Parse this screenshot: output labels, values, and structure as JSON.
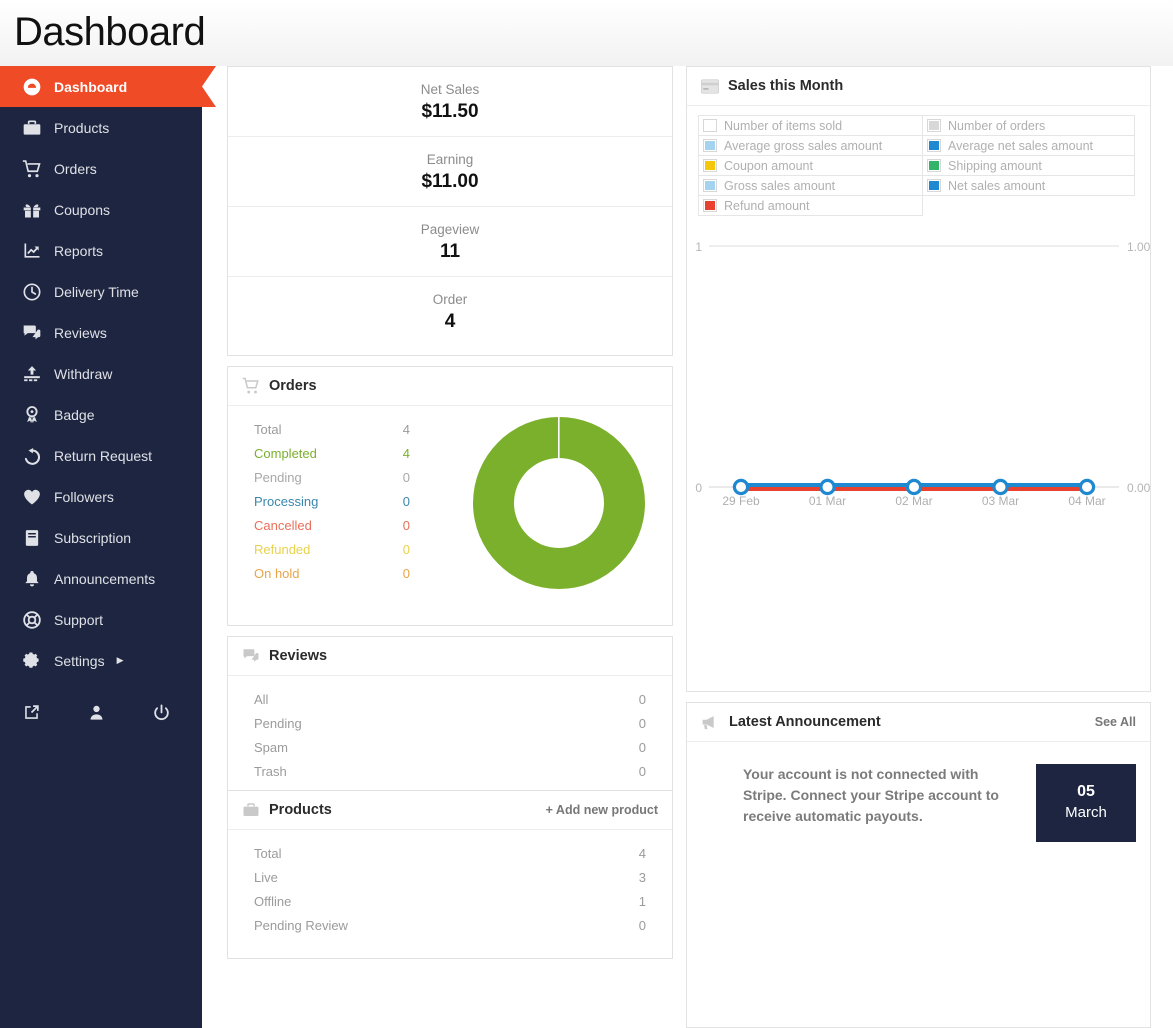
{
  "header": {
    "title": "Dashboard"
  },
  "sidebar": {
    "items": [
      {
        "label": "Dashboard",
        "icon": "gauge-icon",
        "active": true,
        "caret": false
      },
      {
        "label": "Products",
        "icon": "briefcase-icon",
        "active": false,
        "caret": false
      },
      {
        "label": "Orders",
        "icon": "shopping-cart-icon",
        "active": false,
        "caret": false
      },
      {
        "label": "Coupons",
        "icon": "gift-icon",
        "active": false,
        "caret": false
      },
      {
        "label": "Reports",
        "icon": "chart-line-icon",
        "active": false,
        "caret": false
      },
      {
        "label": "Delivery Time",
        "icon": "clock-icon",
        "active": false,
        "caret": false
      },
      {
        "label": "Reviews",
        "icon": "comments-icon",
        "active": false,
        "caret": false
      },
      {
        "label": "Withdraw",
        "icon": "upload-icon",
        "active": false,
        "caret": false
      },
      {
        "label": "Badge",
        "icon": "award-icon",
        "active": false,
        "caret": false
      },
      {
        "label": "Return Request",
        "icon": "undo-icon",
        "active": false,
        "caret": false
      },
      {
        "label": "Followers",
        "icon": "heart-icon",
        "active": false,
        "caret": false
      },
      {
        "label": "Subscription",
        "icon": "book-icon",
        "active": false,
        "caret": false
      },
      {
        "label": "Announcements",
        "icon": "bell-icon",
        "active": false,
        "caret": false
      },
      {
        "label": "Support",
        "icon": "lifebuoy-icon",
        "active": false,
        "caret": false
      },
      {
        "label": "Settings",
        "icon": "gear-icon",
        "active": false,
        "caret": true
      }
    ],
    "footer_icons": [
      "external-link-icon",
      "user-icon",
      "power-icon"
    ],
    "accent_color": "#ef4b26",
    "background_color": "#1d2540"
  },
  "stats": {
    "items": [
      {
        "label": "Net Sales",
        "value": "$11.50"
      },
      {
        "label": "Earning",
        "value": "$11.00"
      },
      {
        "label": "Pageview",
        "value": "11"
      },
      {
        "label": "Order",
        "value": "4"
      }
    ]
  },
  "orders_card": {
    "title": "Orders",
    "icon": "shopping-cart-icon",
    "rows": [
      {
        "label": "Total",
        "value": "4",
        "color": "#9b9b9b"
      },
      {
        "label": "Completed",
        "value": "4",
        "color": "#7ab02c"
      },
      {
        "label": "Pending",
        "value": "0",
        "color": "#a8a8a8"
      },
      {
        "label": "Processing",
        "value": "0",
        "color": "#3a87ad"
      },
      {
        "label": "Cancelled",
        "value": "0",
        "color": "#e8705a"
      },
      {
        "label": "Refunded",
        "value": "0",
        "color": "#e8d24a"
      },
      {
        "label": "On hold",
        "value": "0",
        "color": "#e8a54a"
      }
    ],
    "chart_data": {
      "type": "pie",
      "title": "Orders",
      "categories": [
        "Completed",
        "Pending",
        "Processing",
        "Cancelled",
        "Refunded",
        "On hold"
      ],
      "values": [
        4,
        0,
        0,
        0,
        0,
        0
      ],
      "colors": [
        "#7ab02c",
        "#a8a8a8",
        "#3a87ad",
        "#e8705a",
        "#e8d24a",
        "#e8a54a"
      ],
      "donut": true,
      "legend": "left"
    }
  },
  "reviews_card": {
    "title": "Reviews",
    "icon": "comments-icon",
    "rows": [
      {
        "label": "All",
        "value": "0"
      },
      {
        "label": "Pending",
        "value": "0"
      },
      {
        "label": "Spam",
        "value": "0"
      },
      {
        "label": "Trash",
        "value": "0"
      }
    ]
  },
  "products_card": {
    "title": "Products",
    "icon": "briefcase-icon",
    "action": "+ Add new product",
    "rows": [
      {
        "label": "Total",
        "value": "4"
      },
      {
        "label": "Live",
        "value": "3"
      },
      {
        "label": "Offline",
        "value": "1"
      },
      {
        "label": "Pending Review",
        "value": "0"
      }
    ]
  },
  "sales_card": {
    "title": "Sales this Month",
    "icon": "credit-card-icon",
    "legend_left": [
      {
        "label": "Number of items sold",
        "color": "#ffffff"
      },
      {
        "label": "Average gross sales amount",
        "color": "#a3d3ef"
      },
      {
        "label": "Coupon amount",
        "color": "#f5c70a"
      },
      {
        "label": "Gross sales amount",
        "color": "#a3d3ef"
      },
      {
        "label": "Refund amount",
        "color": "#e8412f"
      }
    ],
    "legend_right": [
      {
        "label": "Number of orders",
        "color": "#d8d8d8"
      },
      {
        "label": "Average net sales amount",
        "color": "#1e88d0"
      },
      {
        "label": "Shipping amount",
        "color": "#34b36a"
      },
      {
        "label": "Net sales amount",
        "color": "#1e88d0"
      }
    ],
    "chart_data": {
      "type": "line",
      "title": "Sales this Month",
      "x": [
        "29 Feb",
        "01 Mar",
        "02 Mar",
        "03 Mar",
        "04 Mar"
      ],
      "series": [
        {
          "name": "Refund amount",
          "values": [
            0,
            0,
            0,
            0,
            0
          ],
          "color": "#e8412f",
          "axis": "right"
        },
        {
          "name": "Net sales amount",
          "values": [
            0,
            0,
            0,
            0,
            0
          ],
          "color": "#1e88d0",
          "axis": "right"
        }
      ],
      "left_axis_ticks": [
        "1",
        "0"
      ],
      "right_axis_ticks": [
        "1.00",
        "0.00"
      ],
      "ylim": [
        0,
        1
      ],
      "ylim_right": [
        0,
        1
      ],
      "xlabel": "",
      "ylabel": "",
      "grid": true,
      "legend": "top"
    }
  },
  "announcement_card": {
    "title": "Latest Announcement",
    "icon": "megaphone-icon",
    "action": "See All",
    "text": "Your account is not connected with Stripe. Connect your Stripe account to receive automatic payouts.",
    "day": "05",
    "month": "March"
  }
}
